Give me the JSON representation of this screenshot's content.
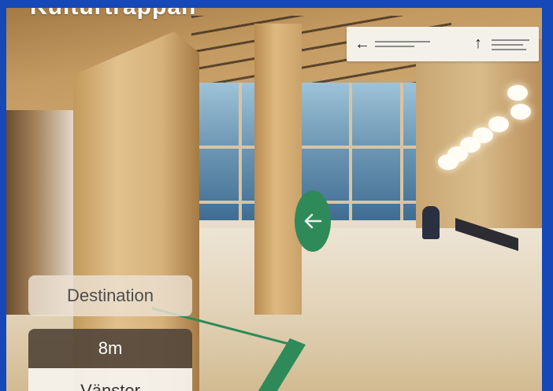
{
  "title": "Kulturtrappan",
  "destination_label": "Destination",
  "distance": "8m",
  "direction": "Vänster",
  "colors": {
    "frame_border": "#1648b8",
    "route_green": "#2f8a5a",
    "distance_panel": "#54473a"
  },
  "icons": {
    "nav_arrow": "arrow-left-icon",
    "sign_left": "arrow-left-icon",
    "sign_up": "arrow-up-icon"
  }
}
